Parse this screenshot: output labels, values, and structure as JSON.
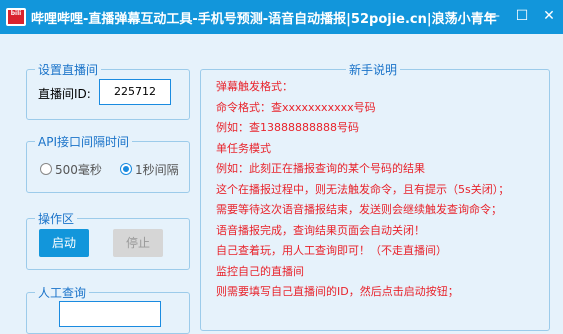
{
  "window": {
    "title": "哔哩哔哩-直播弹幕互动工具-手机号预测-语音自动播报|52pojie.cn|浪荡小青年",
    "icon_name": "bilibili-app-icon",
    "controls": [
      "minimize-icon",
      "maximize-icon",
      "close-icon"
    ]
  },
  "settings": {
    "legend": "设置直播间",
    "room_label": "直播间ID:",
    "room_value": "225712"
  },
  "api": {
    "legend": "API接口间隔时间",
    "options": [
      {
        "label": "500毫秒",
        "selected": false
      },
      {
        "label": "1秒间隔",
        "selected": true
      }
    ]
  },
  "ops": {
    "legend": "操作区",
    "start_label": "启动",
    "stop_label": "停止"
  },
  "manual": {
    "legend": "人工查询"
  },
  "help": {
    "legend": "新手说明",
    "lines": [
      "弹幕触发格式：",
      "命令格式：查xxxxxxxxxxx号码",
      "例如：查13888888888号码",
      "单任务模式",
      "例如：此刻正在播报查询的某个号码的结果",
      "这个在播报过程中，则无法触发命令，且有提示（5s关闭）；",
      "需要等待这次语音播报结束，发送则会继续触发查询命令；",
      "语音播报完成，查询结果页面会自动关闭！",
      "自己查着玩，用人工查询即可！（不走直播间）",
      "监控自己的直播间",
      "则需要填写自己直播间的ID，然后点击启动按钮；"
    ]
  },
  "colors": {
    "titlebar": "#1296db",
    "background": "#e6f2fb",
    "help_text": "#e8232b",
    "accent": "#1a8be0"
  }
}
